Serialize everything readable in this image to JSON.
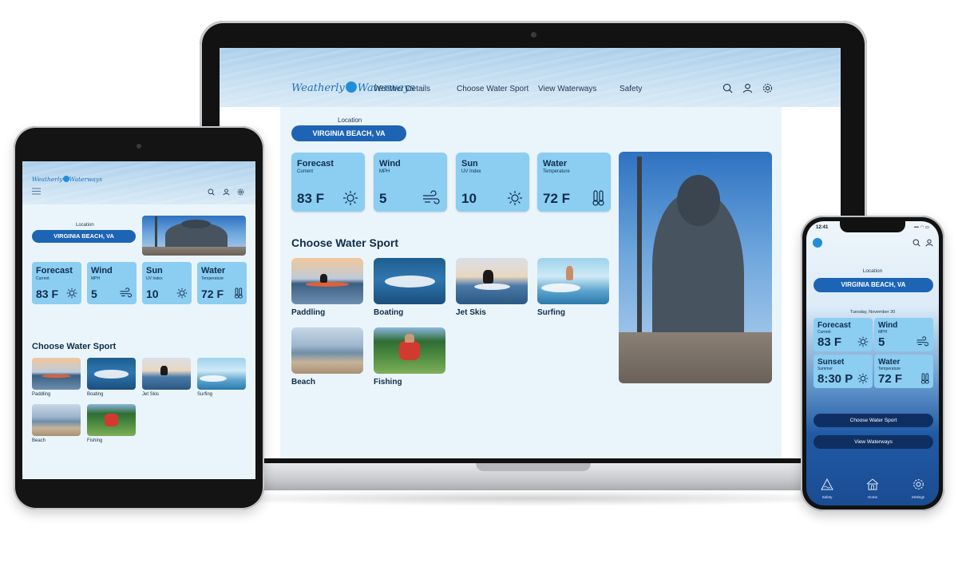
{
  "brand": {
    "name_a": "Weatherly",
    "name_b": "Waterways"
  },
  "nav": [
    {
      "label": "Weather Details"
    },
    {
      "label": "Choose Water Sport"
    },
    {
      "label": "View Waterways"
    },
    {
      "label": "Safety"
    }
  ],
  "header_icons": [
    "search-icon",
    "user-icon",
    "settings-icon"
  ],
  "location": {
    "label": "Location",
    "value": "VIRGINIA BEACH, VA"
  },
  "weather_cards": [
    {
      "title": "Forecast",
      "sub": "Current",
      "value": "83 F",
      "icon": "sun-icon"
    },
    {
      "title": "Wind",
      "sub": "MPH",
      "value": "5",
      "icon": "wind-icon"
    },
    {
      "title": "Sun",
      "sub": "UV Index",
      "value": "10",
      "icon": "sun-icon"
    },
    {
      "title": "Water",
      "sub": "Temperature",
      "value": "72 F",
      "icon": "thermometer-icon"
    }
  ],
  "sports": {
    "title": "Choose Water Sport",
    "items": [
      {
        "label": "Paddling"
      },
      {
        "label": "Boating"
      },
      {
        "label": "Jet Skis"
      },
      {
        "label": "Surfing"
      },
      {
        "label": "Beach"
      },
      {
        "label": "Fishing"
      }
    ]
  },
  "phone": {
    "time": "12:41",
    "status": "▪▪▪ ◠ ▭",
    "date": "Tuesday, November 30",
    "cards": [
      {
        "title": "Forecast",
        "sub": "Current",
        "value": "83 F",
        "icon": "sun-icon"
      },
      {
        "title": "Wind",
        "sub": "MPH",
        "value": "5",
        "icon": "wind-icon"
      },
      {
        "title": "Sunset",
        "sub": "Summer",
        "value": "8:30 P",
        "icon": "sun-icon"
      },
      {
        "title": "Water",
        "sub": "Temperature",
        "value": "72 F",
        "icon": "thermometer-icon"
      }
    ],
    "buttons": {
      "sport": "Choose Water Sport",
      "waterways": "View Waterways"
    },
    "tabs": [
      {
        "label": "Safety",
        "icon": "warning-triangle-icon"
      },
      {
        "label": "Home",
        "icon": "home-icon"
      },
      {
        "label": "Settings",
        "icon": "settings-icon"
      }
    ]
  }
}
